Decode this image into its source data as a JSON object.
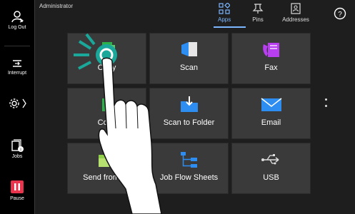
{
  "user": {
    "name": "Administrator"
  },
  "rail": {
    "logout_label": "Log Out",
    "interrupt_label": "Interrupt",
    "jobs_label": "Jobs",
    "pause_label": "Pause"
  },
  "tabs": {
    "apps": "Apps",
    "pins": "Pins",
    "addresses": "Addresses"
  },
  "apps": [
    {
      "label": "Copy"
    },
    {
      "label": "Scan"
    },
    {
      "label": "Fax"
    },
    {
      "label": "Copy"
    },
    {
      "label": "Scan to Folder"
    },
    {
      "label": "Email"
    },
    {
      "label": "Send from Fo"
    },
    {
      "label": "Job Flow Sheets"
    },
    {
      "label": "USB"
    }
  ],
  "colors": {
    "accent": "#7bb6ff",
    "pause": "#e8344c",
    "tap": "#1aa89a"
  }
}
